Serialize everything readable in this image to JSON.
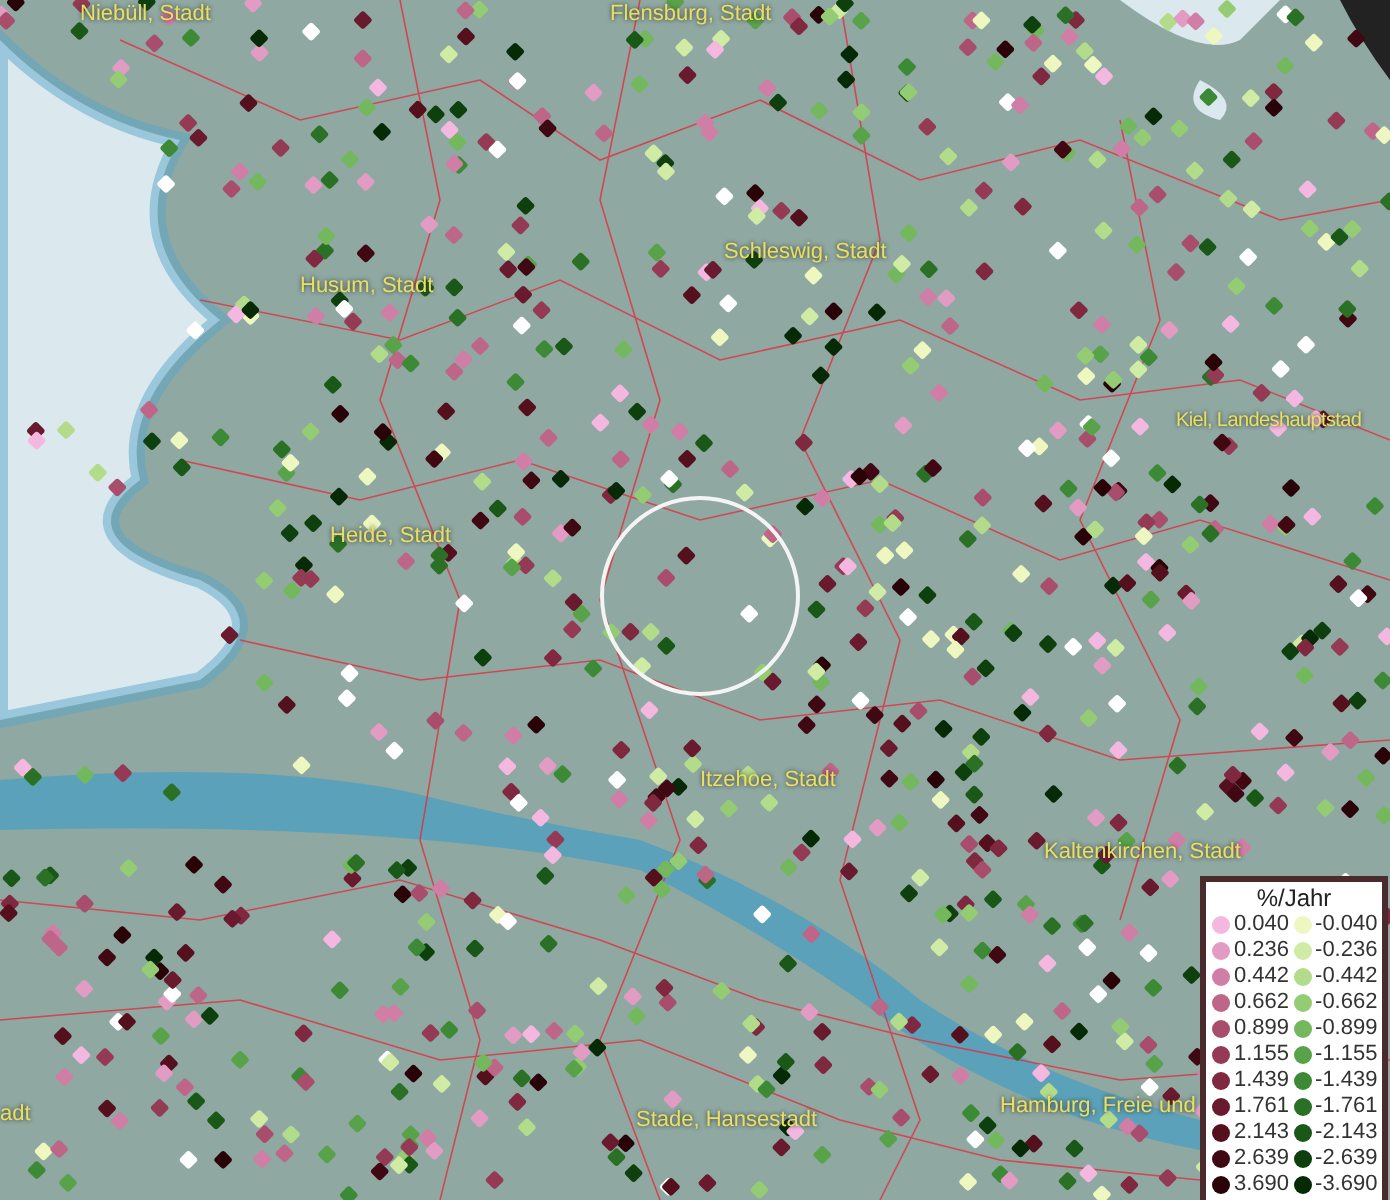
{
  "map": {
    "place_labels": [
      {
        "text": "Niebüll, Stadt"
      },
      {
        "text": "Flensburg, Stadt"
      },
      {
        "text": "Husum, Stadt"
      },
      {
        "text": "Schleswig, Stadt"
      },
      {
        "text": "Kiel, Landeshauptstad"
      },
      {
        "text": "Heide, Stadt"
      },
      {
        "text": "Itzehoe, Stadt"
      },
      {
        "text": "Kaltenkirchen, Stadt"
      },
      {
        "text": "adt"
      },
      {
        "text": "Stade, Hansestadt"
      },
      {
        "text": "Hamburg, Freie und"
      }
    ],
    "legend": {
      "title": "%/Jahr",
      "positive_column": [
        {
          "value": "0.040",
          "color": "#f4b8e0"
        },
        {
          "value": "0.236",
          "color": "#e29cc4"
        },
        {
          "value": "0.442",
          "color": "#d07ea5"
        },
        {
          "value": "0.662",
          "color": "#bd6688"
        },
        {
          "value": "0.899",
          "color": "#a84e6c"
        },
        {
          "value": "1.155",
          "color": "#953a55"
        },
        {
          "value": "1.439",
          "color": "#7f2840"
        },
        {
          "value": "1.761",
          "color": "#6a1a2e"
        },
        {
          "value": "2.143",
          "color": "#55101e"
        },
        {
          "value": "2.639",
          "color": "#400812"
        },
        {
          "value": "3.690",
          "color": "#2a0308"
        }
      ],
      "negative_column": [
        {
          "value": "-0.040",
          "color": "#eef7c0"
        },
        {
          "value": "-0.236",
          "color": "#d0eba3"
        },
        {
          "value": "-0.442",
          "color": "#b2dc8a"
        },
        {
          "value": "-0.662",
          "color": "#94cc74"
        },
        {
          "value": "-0.899",
          "color": "#74b85e"
        },
        {
          "value": "-1.155",
          "color": "#58a24a"
        },
        {
          "value": "-1.439",
          "color": "#3d8a36"
        },
        {
          "value": "-1.761",
          "color": "#2a7126"
        },
        {
          "value": "-2.143",
          "color": "#1a5818"
        },
        {
          "value": "-2.639",
          "color": "#0e400e"
        },
        {
          "value": "-3.690",
          "color": "#052a05"
        }
      ]
    }
  }
}
